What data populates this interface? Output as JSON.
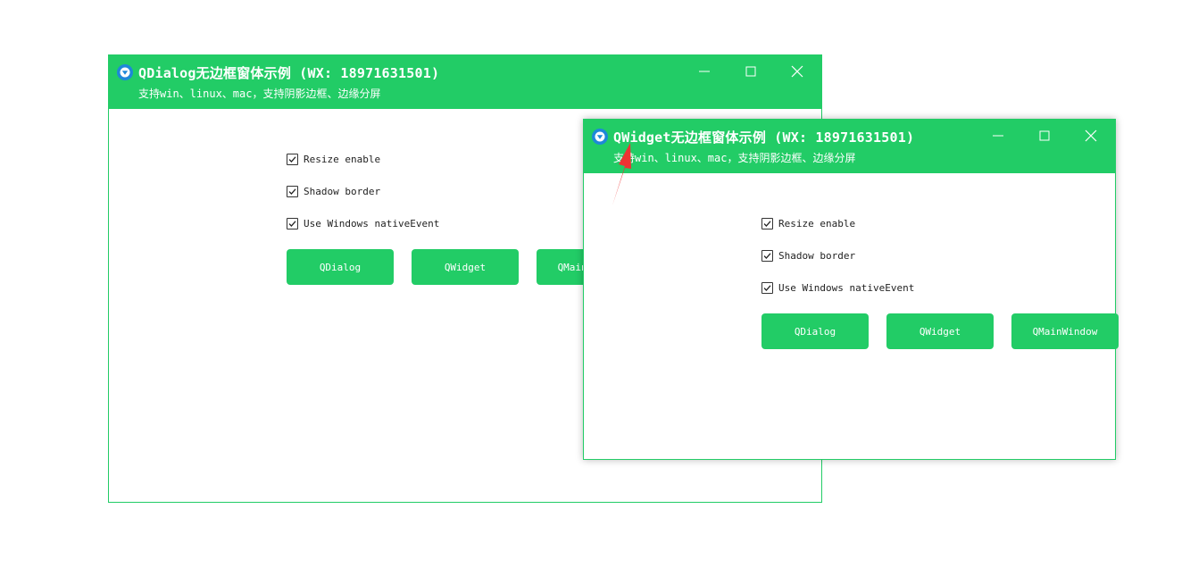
{
  "colors": {
    "accent": "#22cc66",
    "annotation_arrow": "#ee3333"
  },
  "dialog_window": {
    "title": "QDialog无边框窗体示例 (WX: 18971631501)",
    "subtitle": "支持win、linux、mac，支持阴影边框、边缘分屏",
    "controls": {
      "minimize_icon": "minimize-icon",
      "maximize_icon": "maximize-icon",
      "close_icon": "close-icon"
    },
    "checkboxes": [
      {
        "label": "Resize enable",
        "checked": true
      },
      {
        "label": "Shadow border",
        "checked": true
      },
      {
        "label": "Use Windows nativeEvent",
        "checked": true
      }
    ],
    "buttons": [
      "QDialog",
      "QWidget",
      "QMainWindow"
    ]
  },
  "widget_window": {
    "title": "QWidget无边框窗体示例 (WX: 18971631501)",
    "subtitle": "支持win、linux、mac，支持阴影边框、边缘分屏",
    "controls": {
      "minimize_icon": "minimize-icon",
      "maximize_icon": "maximize-icon",
      "close_icon": "close-icon"
    },
    "checkboxes": [
      {
        "label": "Resize enable",
        "checked": true
      },
      {
        "label": "Shadow border",
        "checked": true
      },
      {
        "label": "Use Windows nativeEvent",
        "checked": true
      }
    ],
    "buttons": [
      "QDialog",
      "QWidget",
      "QMainWindow"
    ]
  }
}
